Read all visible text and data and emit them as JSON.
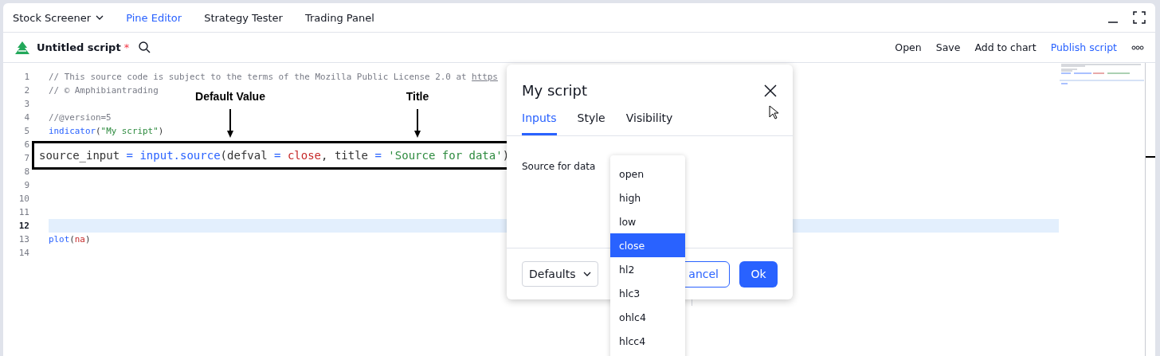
{
  "tabs": [
    {
      "label": "Stock Screener",
      "kind": "menu",
      "selected": false
    },
    {
      "label": "Pine Editor",
      "kind": "tab",
      "selected": true
    },
    {
      "label": "Strategy Tester",
      "kind": "tab",
      "selected": false
    },
    {
      "label": "Trading Panel",
      "kind": "tab",
      "selected": false
    }
  ],
  "toolbar": {
    "title": "Untitled script",
    "modified_mark": "*",
    "actions": [
      {
        "label": "Open",
        "kind": "plain"
      },
      {
        "label": "Save",
        "kind": "plain"
      },
      {
        "label": "Add to chart",
        "kind": "plain"
      },
      {
        "label": "Publish script",
        "kind": "accent"
      }
    ]
  },
  "editor": {
    "lines": [
      {
        "number": "1",
        "selected": false,
        "tokens": [
          {
            "text": "// This source code is subject to the terms of the Mozilla Public License 2.0 at ",
            "kind": "comment"
          },
          {
            "text": "https",
            "kind": "link"
          }
        ]
      },
      {
        "number": "2",
        "selected": false,
        "tokens": [
          {
            "text": "// © Amphibiantrading",
            "kind": "comment"
          }
        ]
      },
      {
        "number": "3",
        "selected": false
      },
      {
        "number": "4",
        "selected": false,
        "tokens": [
          {
            "text": "//@version=5",
            "kind": "comment"
          }
        ]
      },
      {
        "number": "5",
        "selected": false,
        "tokens": [
          {
            "text": "indicator",
            "kind": "function"
          },
          {
            "text": "(",
            "kind": "plain"
          },
          {
            "text": "\"My script\"",
            "kind": "string"
          },
          {
            "text": ")",
            "kind": "plain"
          }
        ]
      },
      {
        "number": "6",
        "selected": false
      },
      {
        "number": "7",
        "selected": false
      },
      {
        "number": "8",
        "selected": false
      },
      {
        "number": "9",
        "selected": false
      },
      {
        "number": "10",
        "selected": false
      },
      {
        "number": "11",
        "selected": false
      },
      {
        "number": "12",
        "selected": true
      },
      {
        "number": "13",
        "selected": false,
        "tokens": [
          {
            "text": "plot",
            "kind": "function"
          },
          {
            "text": "(",
            "kind": "plain"
          },
          {
            "text": "na",
            "kind": "variable"
          },
          {
            "text": ")",
            "kind": "plain"
          }
        ]
      },
      {
        "number": "14",
        "selected": false
      }
    ]
  },
  "callout": {
    "tokens": [
      {
        "text": "source_input ",
        "kind": "plain"
      },
      {
        "text": "= input.source",
        "kind": "function"
      },
      {
        "text": "(defval ",
        "kind": "plain"
      },
      {
        "text": "= ",
        "kind": "function"
      },
      {
        "text": "close",
        "kind": "variable"
      },
      {
        "text": ", title ",
        "kind": "plain"
      },
      {
        "text": "= ",
        "kind": "function"
      },
      {
        "text": "'Source for data'",
        "kind": "string"
      },
      {
        "text": ")",
        "kind": "plain"
      }
    ],
    "labels": [
      {
        "text": "Default Value"
      },
      {
        "text": "Title"
      }
    ]
  },
  "dialog": {
    "title": "My script",
    "tabs": [
      {
        "label": "Inputs",
        "selected": true
      },
      {
        "label": "Style",
        "selected": false
      },
      {
        "label": "Visibility",
        "selected": false
      }
    ],
    "field_label": "Source for data",
    "dropdown": {
      "options": [
        {
          "label": "open",
          "selected": false
        },
        {
          "label": "high",
          "selected": false
        },
        {
          "label": "low",
          "selected": false
        },
        {
          "label": "close",
          "selected": true
        },
        {
          "label": "hl2",
          "selected": false
        },
        {
          "label": "hlc3",
          "selected": false
        },
        {
          "label": "ohlc4",
          "selected": false
        },
        {
          "label": "hlcc4",
          "selected": false
        }
      ]
    },
    "defaults_button": "Defaults",
    "cancel_button": "ancel",
    "ok_button": "Ok"
  }
}
